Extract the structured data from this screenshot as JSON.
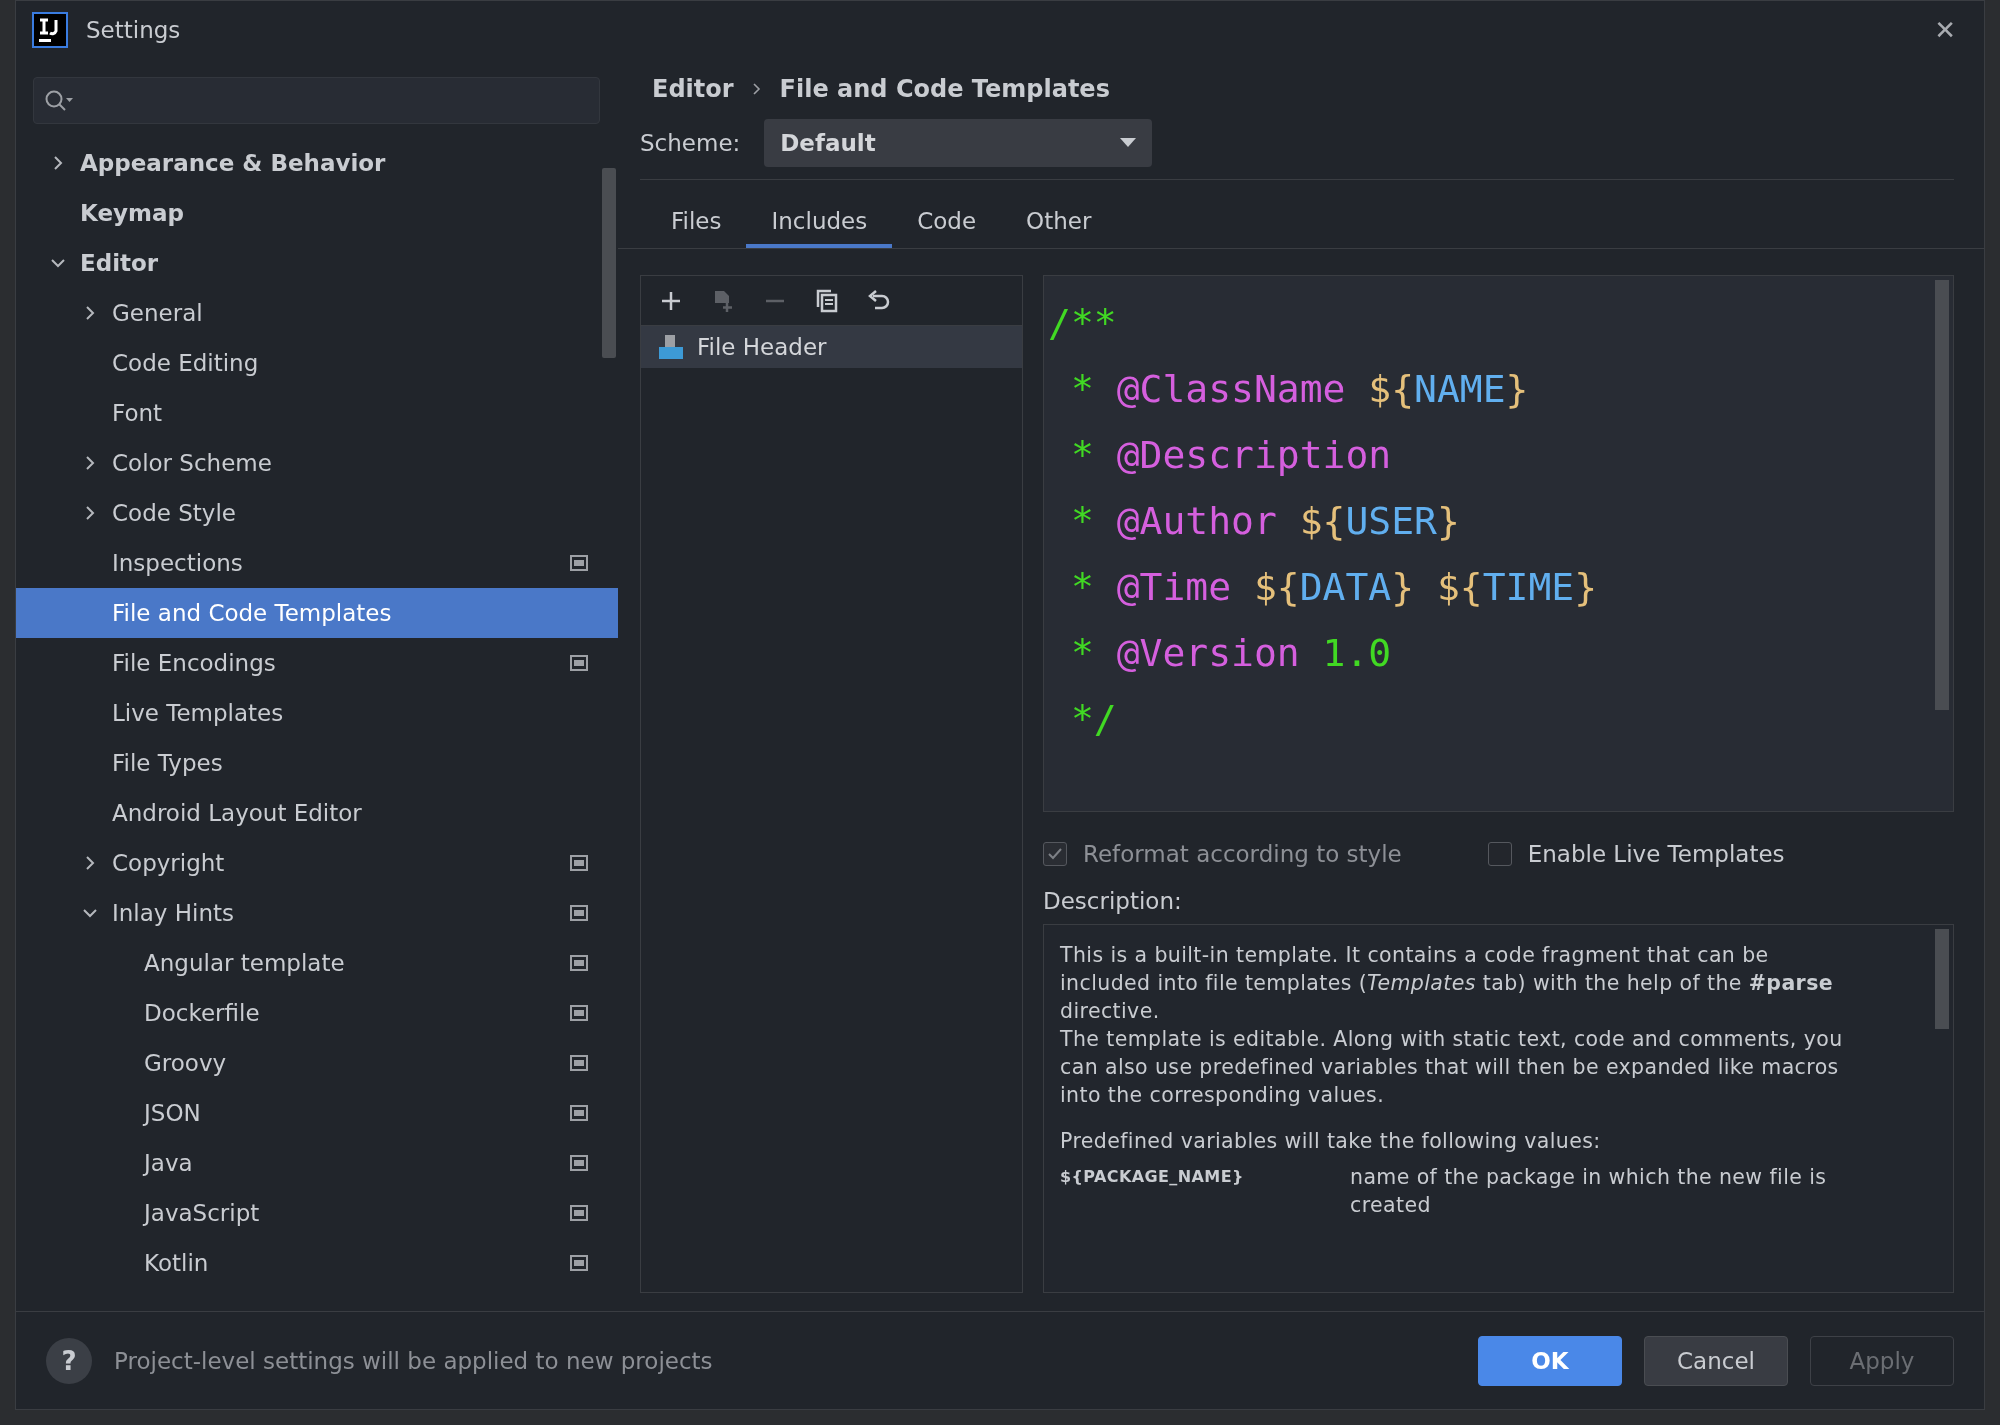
{
  "window": {
    "title": "Settings",
    "close": "✕"
  },
  "sidebar": {
    "items": [
      {
        "label": "Appearance & Behavior",
        "expanded": false,
        "selected": false,
        "project_level": false
      },
      {
        "label": "Keymap",
        "selected": false,
        "project_level": false
      },
      {
        "label": "Editor",
        "expanded": true,
        "selected": false,
        "project_level": false,
        "children": [
          {
            "label": "General",
            "expanded": false,
            "selected": false,
            "project_level": false
          },
          {
            "label": "Code Editing",
            "selected": false,
            "project_level": false
          },
          {
            "label": "Font",
            "selected": false,
            "project_level": false
          },
          {
            "label": "Color Scheme",
            "expanded": false,
            "selected": false,
            "project_level": false
          },
          {
            "label": "Code Style",
            "expanded": false,
            "selected": false,
            "project_level": false
          },
          {
            "label": "Inspections",
            "selected": false,
            "project_level": true
          },
          {
            "label": "File and Code Templates",
            "selected": true,
            "project_level": false
          },
          {
            "label": "File Encodings",
            "selected": false,
            "project_level": true
          },
          {
            "label": "Live Templates",
            "selected": false,
            "project_level": false
          },
          {
            "label": "File Types",
            "selected": false,
            "project_level": false
          },
          {
            "label": "Android Layout Editor",
            "selected": false,
            "project_level": false
          },
          {
            "label": "Copyright",
            "expanded": false,
            "selected": false,
            "project_level": true
          },
          {
            "label": "Inlay Hints",
            "expanded": true,
            "selected": false,
            "project_level": true,
            "children": [
              {
                "label": "Angular template",
                "selected": false,
                "project_level": true
              },
              {
                "label": "Dockerfile",
                "selected": false,
                "project_level": true
              },
              {
                "label": "Groovy",
                "selected": false,
                "project_level": true
              },
              {
                "label": "JSON",
                "selected": false,
                "project_level": true
              },
              {
                "label": "Java",
                "selected": false,
                "project_level": true
              },
              {
                "label": "JavaScript",
                "selected": false,
                "project_level": true
              },
              {
                "label": "Kotlin",
                "selected": false,
                "project_level": true
              }
            ]
          }
        ]
      }
    ]
  },
  "breadcrumb": [
    "Editor",
    "File and Code Templates"
  ],
  "scheme": {
    "label": "Scheme:",
    "value": "Default"
  },
  "tabs": [
    {
      "label": "Files",
      "selected": false
    },
    {
      "label": "Includes",
      "selected": true
    },
    {
      "label": "Code",
      "selected": false
    },
    {
      "label": "Other",
      "selected": false
    }
  ],
  "toolbar": [
    {
      "kind": "add",
      "disabled": false
    },
    {
      "kind": "add-child",
      "disabled": true
    },
    {
      "kind": "remove",
      "disabled": true
    },
    {
      "kind": "copy",
      "disabled": false
    },
    {
      "kind": "reset",
      "disabled": false
    }
  ],
  "templates": [
    {
      "label": "File Header",
      "selected": true
    }
  ],
  "code": [
    [
      {
        "kind": "comment",
        "text": "/**"
      }
    ],
    [
      {
        "kind": "comment",
        "text": " * "
      },
      {
        "kind": "tag",
        "text": "@ClassName "
      },
      {
        "kind": "brace",
        "text": "${"
      },
      {
        "kind": "var",
        "text": "NAME"
      },
      {
        "kind": "brace",
        "text": "}"
      }
    ],
    [
      {
        "kind": "comment",
        "text": " * "
      },
      {
        "kind": "tag",
        "text": "@Description"
      }
    ],
    [
      {
        "kind": "comment",
        "text": " * "
      },
      {
        "kind": "tag",
        "text": "@Author "
      },
      {
        "kind": "brace",
        "text": "${"
      },
      {
        "kind": "var",
        "text": "USER"
      },
      {
        "kind": "brace",
        "text": "}"
      }
    ],
    [
      {
        "kind": "comment",
        "text": " * "
      },
      {
        "kind": "tag",
        "text": "@Time "
      },
      {
        "kind": "brace",
        "text": "${"
      },
      {
        "kind": "var",
        "text": "DATA"
      },
      {
        "kind": "brace",
        "text": "} ${"
      },
      {
        "kind": "var",
        "text": "TIME"
      },
      {
        "kind": "brace",
        "text": "}"
      }
    ],
    [
      {
        "kind": "comment",
        "text": " * "
      },
      {
        "kind": "tag",
        "text": "@Version "
      },
      {
        "kind": "comment",
        "text": "1.0"
      }
    ],
    [
      {
        "kind": "comment",
        "text": " */"
      }
    ]
  ],
  "options": [
    {
      "label": "Reformat according to style",
      "checked": true,
      "disabled": true
    },
    {
      "label": "Enable Live Templates",
      "checked": false,
      "disabled": false
    }
  ],
  "description": {
    "label": "Description:",
    "paragraphs": [
      "This is a built-in template. It contains a code fragment that can be included into file templates (*Templates* tab) with the help of the **#parse** directive.",
      "The template is editable. Along with static text, code and comments, you can also use predefined variables that will then be expanded like macros into the corresponding values.",
      "Predefined variables will take the following values:"
    ],
    "variables": [
      {
        "name": "${PACKAGE_NAME}",
        "meaning": "name of the package in which the new file is created"
      }
    ]
  },
  "footer": {
    "help": "?",
    "note": "Project-level settings will be applied to new projects",
    "buttons": [
      {
        "label": "OK",
        "kind": "primary"
      },
      {
        "label": "Cancel",
        "kind": "normal"
      },
      {
        "label": "Apply",
        "kind": "disabled"
      }
    ]
  }
}
